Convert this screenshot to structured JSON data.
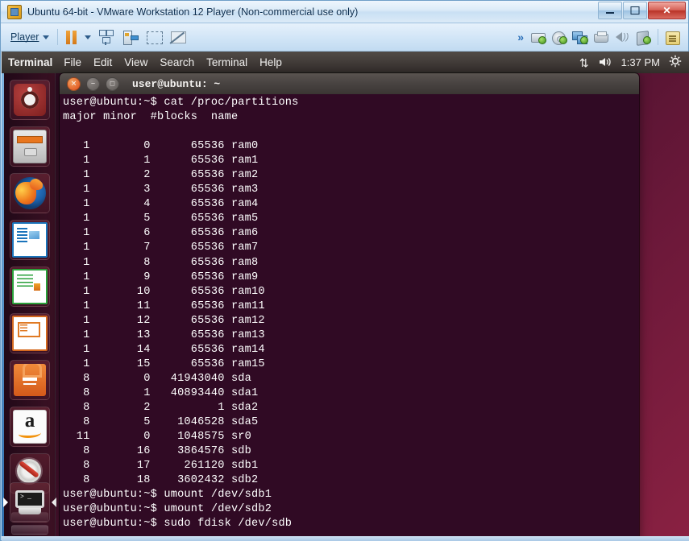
{
  "vmware": {
    "window_title": "Ubuntu 64-bit - VMware Workstation 12 Player (Non-commercial use only)",
    "app_icon": "vmware-icon",
    "window_controls": {
      "minimize": "minimize-icon",
      "maximize": "maximize-icon",
      "close": "✕"
    },
    "toolbar": {
      "player_menu": "Player",
      "player_accesskey": "P",
      "pause_button": "pause-icon",
      "pause_dropdown": "chevron-down-icon",
      "buttons": [
        {
          "name": "unity-mode-icon",
          "label": "Unity"
        },
        {
          "name": "send-key-icon",
          "label": "Send Key"
        },
        {
          "name": "full-screen-icon",
          "label": "Full Screen"
        },
        {
          "name": "no-preview-icon",
          "label": "Disable Preview"
        }
      ],
      "overflow": "»",
      "status_icons": [
        {
          "name": "hard-disk-status-icon",
          "label": "Hard Disk"
        },
        {
          "name": "cd-dvd-status-icon",
          "label": "CD/DVD"
        },
        {
          "name": "network-adapter-status-icon",
          "label": "Network Adapter"
        },
        {
          "name": "printer-status-icon",
          "label": "Printer"
        },
        {
          "name": "sound-card-status-icon",
          "label": "Sound Card"
        },
        {
          "name": "usb-device-status-icon",
          "label": "USB Device"
        },
        {
          "name": "message-log-icon",
          "label": "Message Log"
        }
      ]
    }
  },
  "ubuntu_panel": {
    "app_name": "Terminal",
    "menus": [
      "File",
      "Edit",
      "View",
      "Search",
      "Terminal",
      "Help"
    ],
    "indicators": [
      {
        "name": "network-indicator-icon",
        "glyph": "⇅"
      },
      {
        "name": "volume-indicator-icon",
        "glyph": "🔊"
      }
    ],
    "clock": "1:37 PM",
    "session_icon": "gear-icon"
  },
  "launcher": {
    "items": [
      {
        "name": "launcher-item-dash",
        "label": "Dash Home",
        "icon": "ubuntu-logo-icon",
        "active": false
      },
      {
        "name": "launcher-item-files",
        "label": "Files",
        "icon": "file-manager-icon",
        "active": false
      },
      {
        "name": "launcher-item-firefox",
        "label": "Firefox Web Browser",
        "icon": "firefox-icon",
        "active": false
      },
      {
        "name": "launcher-item-writer",
        "label": "LibreOffice Writer",
        "icon": "libreoffice-writer-icon",
        "active": false
      },
      {
        "name": "launcher-item-calc",
        "label": "LibreOffice Calc",
        "icon": "libreoffice-calc-icon",
        "active": false
      },
      {
        "name": "launcher-item-impress",
        "label": "LibreOffice Impress",
        "icon": "libreoffice-impress-icon",
        "active": false
      },
      {
        "name": "launcher-item-software-center",
        "label": "Ubuntu Software Center",
        "icon": "software-center-icon",
        "active": false
      },
      {
        "name": "launcher-item-amazon",
        "label": "Amazon",
        "icon": "amazon-icon",
        "active": false
      },
      {
        "name": "launcher-item-system-settings",
        "label": "System Settings",
        "icon": "system-settings-icon",
        "active": false
      },
      {
        "name": "launcher-item-terminal",
        "label": "Terminal",
        "icon": "terminal-icon",
        "active": true
      }
    ],
    "amazon_letter": "a"
  },
  "terminal": {
    "title": "user@ubuntu: ~",
    "controls": {
      "close": "✕",
      "minimize": "−",
      "maximize": "□"
    },
    "prompt": "user@ubuntu:~$",
    "scrollbar_color": "#f47421",
    "content": "user@ubuntu:~$ cat /proc/partitions\nmajor minor  #blocks  name\n\n   1        0      65536 ram0\n   1        1      65536 ram1\n   1        2      65536 ram2\n   1        3      65536 ram3\n   1        4      65536 ram4\n   1        5      65536 ram5\n   1        6      65536 ram6\n   1        7      65536 ram7\n   1        8      65536 ram8\n   1        9      65536 ram9\n   1       10      65536 ram10\n   1       11      65536 ram11\n   1       12      65536 ram12\n   1       13      65536 ram13\n   1       14      65536 ram14\n   1       15      65536 ram15\n   8        0   41943040 sda\n   8        1   40893440 sda1\n   8        2          1 sda2\n   8        5    1046528 sda5\n  11        0    1048575 sr0\n   8       16    3864576 sdb\n   8       17     261120 sdb1\n   8       18    3602432 sdb2\nuser@ubuntu:~$ umount /dev/sdb1\nuser@ubuntu:~$ umount /dev/sdb2\nuser@ubuntu:~$ sudo fdisk /dev/sdb",
    "commands": [
      "cat /proc/partitions",
      "umount /dev/sdb1",
      "umount /dev/sdb2",
      "sudo fdisk /dev/sdb"
    ],
    "table": {
      "headers": [
        "major",
        "minor",
        "#blocks",
        "name"
      ],
      "rows": [
        [
          "1",
          "0",
          "65536",
          "ram0"
        ],
        [
          "1",
          "1",
          "65536",
          "ram1"
        ],
        [
          "1",
          "2",
          "65536",
          "ram2"
        ],
        [
          "1",
          "3",
          "65536",
          "ram3"
        ],
        [
          "1",
          "4",
          "65536",
          "ram4"
        ],
        [
          "1",
          "5",
          "65536",
          "ram5"
        ],
        [
          "1",
          "6",
          "65536",
          "ram6"
        ],
        [
          "1",
          "7",
          "65536",
          "ram7"
        ],
        [
          "1",
          "8",
          "65536",
          "ram8"
        ],
        [
          "1",
          "9",
          "65536",
          "ram9"
        ],
        [
          "1",
          "10",
          "65536",
          "ram10"
        ],
        [
          "1",
          "11",
          "65536",
          "ram11"
        ],
        [
          "1",
          "12",
          "65536",
          "ram12"
        ],
        [
          "1",
          "13",
          "65536",
          "ram13"
        ],
        [
          "1",
          "14",
          "65536",
          "ram14"
        ],
        [
          "1",
          "15",
          "65536",
          "ram15"
        ],
        [
          "8",
          "0",
          "41943040",
          "sda"
        ],
        [
          "8",
          "1",
          "40893440",
          "sda1"
        ],
        [
          "8",
          "2",
          "1",
          "sda2"
        ],
        [
          "8",
          "5",
          "1046528",
          "sda5"
        ],
        [
          "11",
          "0",
          "1048575",
          "sr0"
        ],
        [
          "8",
          "16",
          "3864576",
          "sdb"
        ],
        [
          "8",
          "17",
          "261120",
          "sdb1"
        ],
        [
          "8",
          "18",
          "3602432",
          "sdb2"
        ]
      ]
    }
  },
  "colors": {
    "terminal_bg": "#300a24",
    "terminal_fg": "#ffffff",
    "ubuntu_orange": "#f47421",
    "panel_bg": "#403a37",
    "desktop_gradient_start": "#2b0b20",
    "desktop_gradient_end": "#8a2142"
  }
}
